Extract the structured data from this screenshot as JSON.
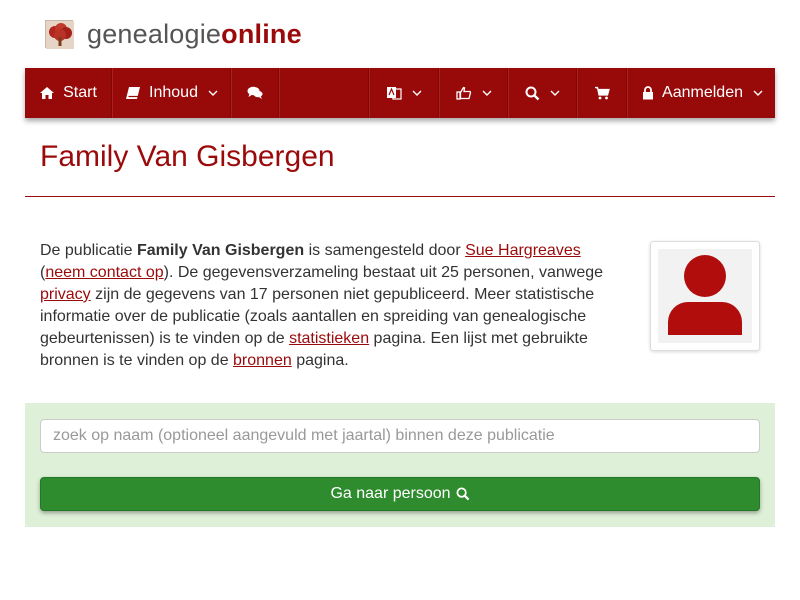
{
  "brand": {
    "name_part1": "genealogie",
    "name_part2": "online"
  },
  "nav": {
    "start_label": "Start",
    "content_label": "Inhoud",
    "login_label": "Aanmelden"
  },
  "page": {
    "title": "Family Van Gisbergen"
  },
  "intro": {
    "t1": "De publicatie ",
    "pub_name": "Family Van Gisbergen",
    "t2": " is samengesteld door ",
    "author_link": "Sue Hargreaves",
    "t3": " (",
    "contact_link": "neem contact op",
    "t4": "). De gegevensverzameling bestaat uit 25 personen, vanwege ",
    "privacy_link": "privacy",
    "t5": " zijn de gegevens van 17 personen niet gepubliceerd. Meer statistische informatie over de publicatie (zoals aantallen en spreiding van genealogische gebeurtenissen) is te vinden op de ",
    "stats_link": "statistieken",
    "t6": " pagina. Een lijst met gebruikte bronnen is te vinden op de ",
    "sources_link": "bronnen",
    "t7": " pagina."
  },
  "search": {
    "placeholder": "zoek op naam (optioneel aangevuld met jaartal) binnen deze publicatie",
    "button_label": "Ga naar persoon"
  },
  "colors": {
    "brand_red": "#980a0a",
    "panel_green": "#dff0d8",
    "button_green": "#2e8b2e"
  }
}
